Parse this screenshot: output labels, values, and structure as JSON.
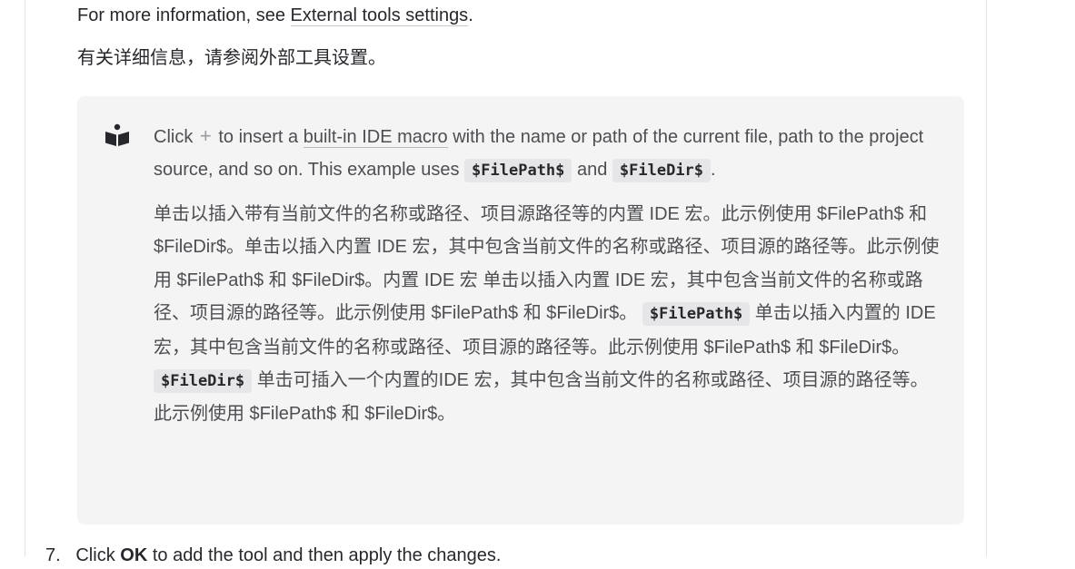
{
  "intro": {
    "en_prefix": "For more information, see ",
    "en_link": "External tools settings",
    "en_suffix": ".",
    "zh": "有关详细信息，请参阅外部工具设置。"
  },
  "note": {
    "icon": "reader-tip-icon",
    "en_1": "Click",
    "plus_glyph": "+",
    "en_2": "to insert a",
    "macro_link": "built-in IDE macro",
    "en_3": "with the name or path of the current file, path to the project source, and so on. This example uses",
    "code_1": "$FilePath$",
    "en_4": "and",
    "code_2": "$FileDir$",
    "en_5": ".",
    "zh_1": "单击以插入带有当前文件的名称或路径、项目源路径等的内置 IDE 宏。此示例使用 $FilePath$ 和 $FileDir$。单击以插入内置 IDE 宏，其中包含当前文件的名称或路径、项目源的路径等。此示例使用 $FilePath$ 和 $FileDir$。内置 IDE 宏 单击以插入内置 IDE 宏，其中包含当前文件的名称或路径、项目源的路径等。此示例使用 $FilePath$ 和 $FileDir$。",
    "zh_code_1": "$FilePath$",
    "zh_2": "单击以插入内置的 IDE 宏，其中包含当前文件的名称或路径、项目源的路径等。此示例使用 $FilePath$ 和 $FileDir$。",
    "zh_code_2": "$FileDir$",
    "zh_3": "单击可插入一个内置的IDE 宏，其中包含当前文件的名称或路径、项目源的路径等。此示例使用 $FilePath$ 和 $FileDir$。"
  },
  "step": {
    "number": "7.",
    "text_1": "Click",
    "bold": "OK",
    "text_2": "to add the tool and then apply the changes."
  },
  "colors": {
    "text": "#27282c",
    "note_bg": "#f4f4f4",
    "code_bg": "#e6e6e8"
  }
}
